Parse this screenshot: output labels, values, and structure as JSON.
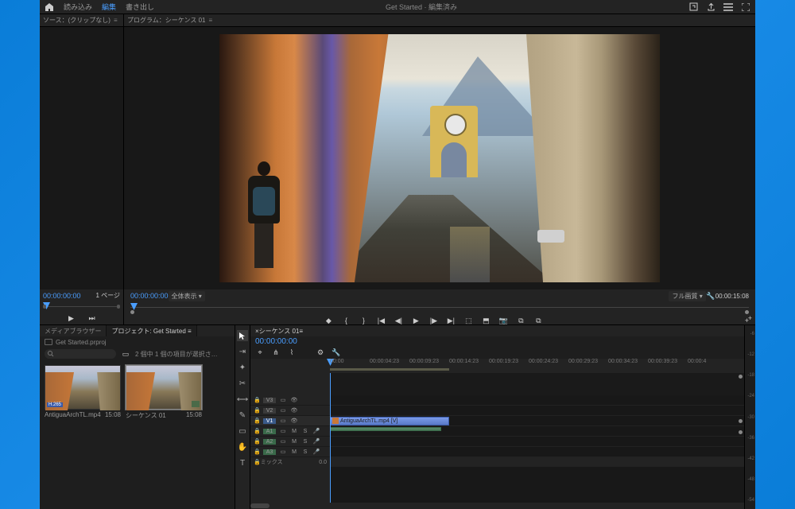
{
  "title": "Get Started · 編集済み",
  "top_tabs": {
    "import": "読み込み",
    "edit": "編集",
    "export": "書き出し"
  },
  "source": {
    "title": "ソース：(クリップなし)",
    "tc": "00:00:00:00",
    "page": "1 ページ"
  },
  "program": {
    "title": "プログラム：シーケンス 01",
    "tc": "00:00:00:00",
    "fit": "全体表示",
    "quality": "フル画質",
    "duration": "00:00:15:08"
  },
  "project": {
    "tab_media": "メディアブラウザー",
    "tab_project": "プロジェクト: Get Started",
    "bin": "Get Started.prproj",
    "count_prefix": "2 個中 1 個の項目が選択さ…",
    "items": [
      {
        "name": "AntiguaArchTL.mp4",
        "dur": "15:08",
        "badge": "H.265"
      },
      {
        "name": "シーケンス 01",
        "dur": "15:08"
      }
    ]
  },
  "timeline": {
    "title": "シーケンス 01",
    "tc": "00:00:00:00",
    "ticks": [
      "00:00",
      "00:00:04:23",
      "00:00:09:23",
      "00:00:14:23",
      "00:00:19:23",
      "00:00:24:23",
      "00:00:29:23",
      "00:00:34:23",
      "00:00:39:23",
      "00:00:4"
    ],
    "tracks": {
      "v3": "V3",
      "v2": "V2",
      "v1": "V1",
      "a1": "A1",
      "a2": "A2",
      "a3": "A3",
      "mix": "ミックス",
      "mix_val": "0.0"
    },
    "clip_name": "AntiguaArchTL.mp4 [V]"
  },
  "meter_ticks": [
    "-6",
    "-12",
    "-18",
    "-24",
    "-30",
    "-36",
    "-42",
    "-48",
    "-54"
  ]
}
